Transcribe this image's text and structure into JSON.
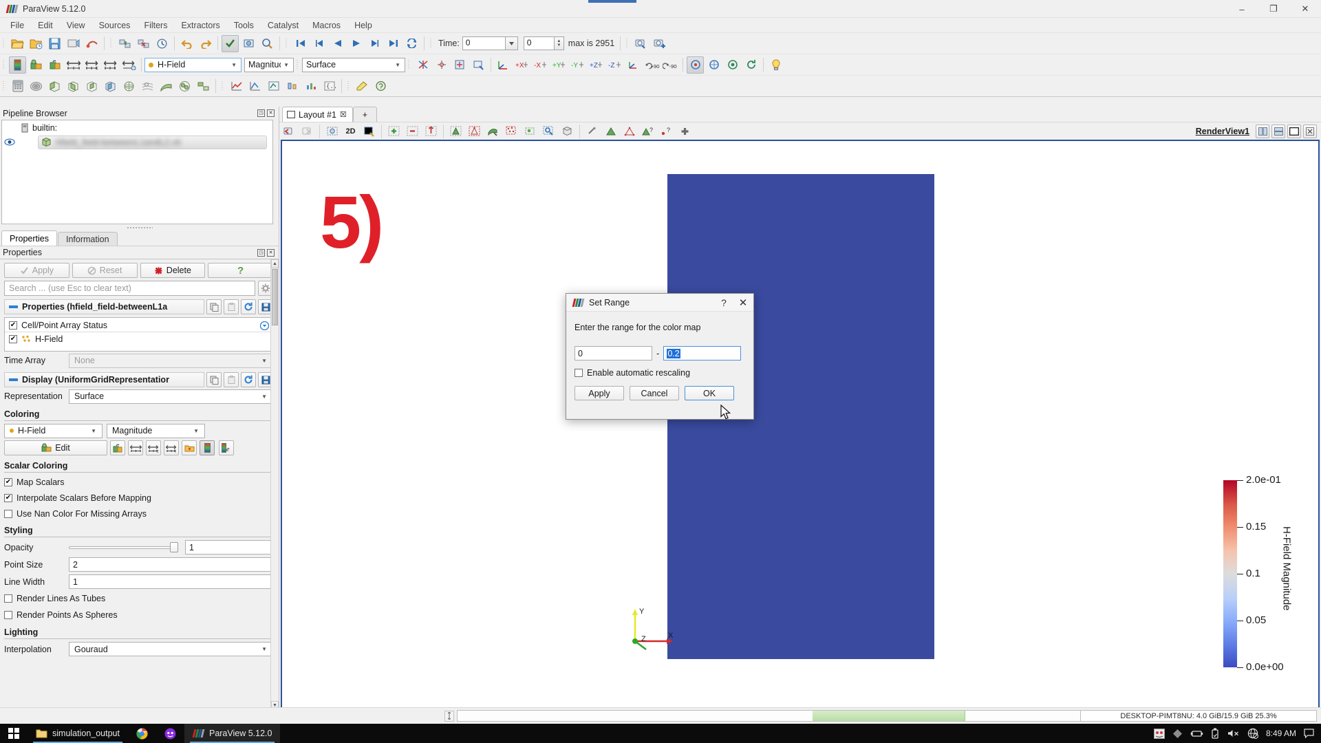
{
  "window": {
    "title": "ParaView 5.12.0",
    "minimize": "–",
    "maximize": "❐",
    "close": "✕"
  },
  "menubar": {
    "items": [
      "File",
      "Edit",
      "View",
      "Sources",
      "Filters",
      "Extractors",
      "Tools",
      "Catalyst",
      "Macros",
      "Help"
    ]
  },
  "time_toolbar": {
    "label": "Time:",
    "time_value": "0",
    "frame_value": "0",
    "max_text": "max is 2951"
  },
  "coloring_toolbar": {
    "array": "H-Field",
    "component": "Magnitude",
    "representation": "Surface"
  },
  "pipeline_browser": {
    "title": "Pipeline Browser",
    "builtin": "builtin:",
    "selected_item": "hfield_field-betweenL1andL2.vti"
  },
  "properties_panel": {
    "tabs": [
      {
        "label": "Properties",
        "selected": true
      },
      {
        "label": "Information",
        "selected": false
      }
    ],
    "title": "Properties",
    "buttons": {
      "apply": "Apply",
      "reset": "Reset",
      "delete": "Delete",
      "help": "?"
    },
    "search_placeholder": "Search ... (use Esc to clear text)",
    "properties_group": "Properties (hfield_field-betweenL1a",
    "cell_point_array_status": "Cell/Point Array Status",
    "array_name": "H-Field",
    "time_array_label": "Time Array",
    "time_array_value": "None",
    "display_group": "Display (UniformGridRepresentatior",
    "representation_label": "Representation",
    "representation_value": "Surface",
    "coloring_label": "Coloring",
    "coloring_array": "H-Field",
    "coloring_component": "Magnitude",
    "edit_button": "Edit",
    "scalar_coloring_label": "Scalar Coloring",
    "map_scalars": "Map Scalars",
    "interpolate_scalars": "Interpolate Scalars Before Mapping",
    "use_nan_color": "Use Nan Color For Missing Arrays",
    "styling_label": "Styling",
    "opacity_label": "Opacity",
    "opacity_value": "1",
    "point_size_label": "Point Size",
    "point_size_value": "2",
    "line_width_label": "Line Width",
    "line_width_value": "1",
    "render_lines_as_tubes": "Render Lines As Tubes",
    "render_points_as_spheres": "Render Points As Spheres",
    "lighting_label": "Lighting",
    "interpolation_label": "Interpolation",
    "interpolation_value": "Gouraud"
  },
  "layout": {
    "tab_label": "Layout #1",
    "tab_close": "☒",
    "add_tab": "+",
    "two_d_button": "2D",
    "render_view_name": "RenderView1"
  },
  "render_view": {
    "annotation": "5)",
    "axes": {
      "x": "X",
      "y": "Y",
      "z": "Z"
    },
    "data_color": "#3a4a9e"
  },
  "color_legend": {
    "title": "H-Field Magnitude",
    "ticks": [
      "2.0e-01",
      "0.15",
      "0.1",
      "0.05",
      "0.0e+00"
    ],
    "tick_positions": [
      0,
      25,
      50,
      75,
      100
    ],
    "colormap_low": "#3b4cc0",
    "colormap_high": "#b40426"
  },
  "dialog": {
    "title": "Set Range",
    "help_icon": "?",
    "close_icon": "✕",
    "message": "Enter the range for the color map",
    "min_value": "0",
    "separator": "-",
    "max_value": "0.2",
    "auto_rescale_label": "Enable automatic rescaling",
    "auto_rescale_checked": false,
    "buttons": {
      "apply": "Apply",
      "cancel": "Cancel",
      "ok": "OK"
    }
  },
  "status_bar": {
    "memory": "DESKTOP-PIMT8NU: 4.0 GiB/15.9 GiB 25.3%"
  },
  "taskbar": {
    "items": [
      {
        "label": "simulation_output",
        "icon": "folder-icon",
        "active": false
      },
      {
        "label": "",
        "icon": "chrome-icon",
        "active": false
      },
      {
        "label": "",
        "icon": "app-icon",
        "active": false
      },
      {
        "label": "ParaView 5.12.0",
        "icon": "paraview-icon",
        "active": true
      }
    ],
    "clock": "8:49 AM"
  }
}
